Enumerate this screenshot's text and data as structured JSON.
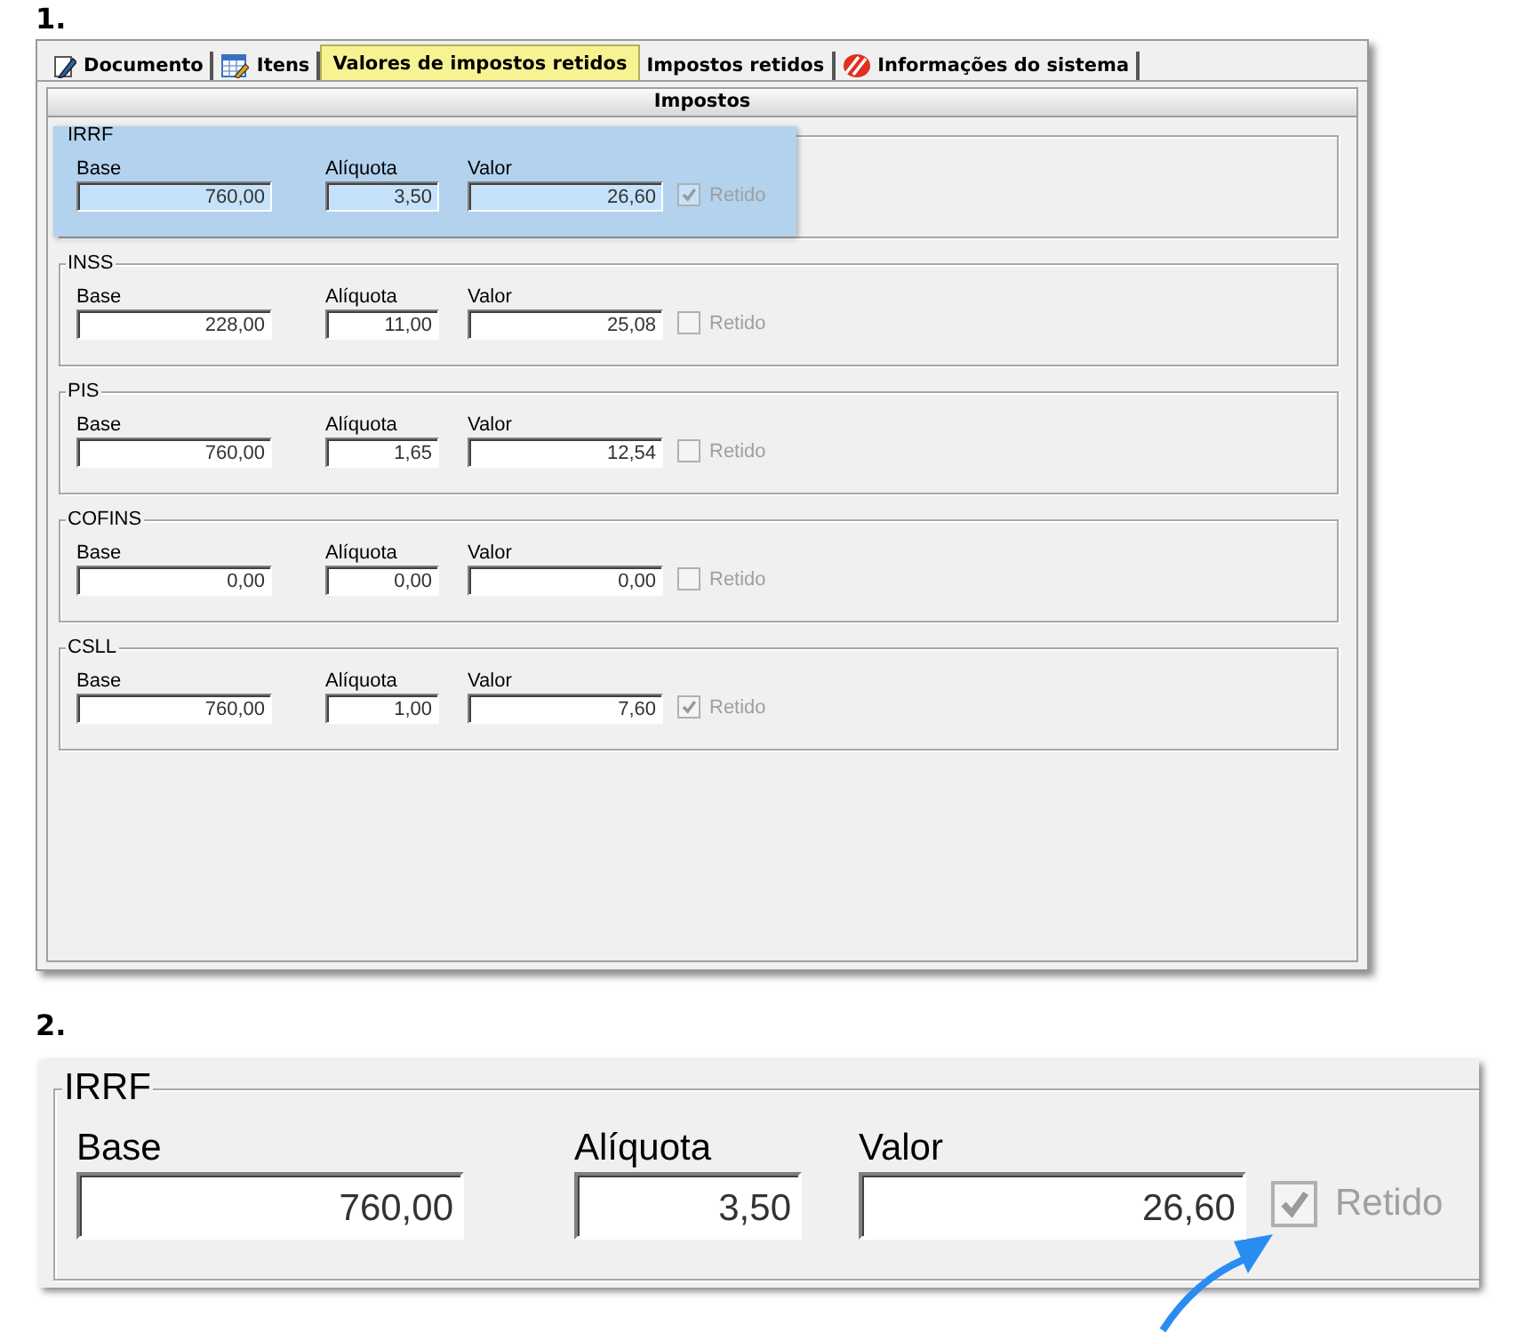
{
  "step_1": {
    "label": "1.",
    "tabs": [
      {
        "label": "Documento",
        "selected": false
      },
      {
        "label": "Itens",
        "selected": false
      },
      {
        "label": "Valores de impostos retidos",
        "selected": true
      },
      {
        "label": "Impostos retidos",
        "selected": false
      },
      {
        "label": "Informações do sistema",
        "selected": false
      }
    ],
    "panel_title": "Impostos",
    "groups": [
      {
        "title": "IRRF",
        "highlighted": true,
        "fields": [
          {
            "label": "Base",
            "value": "760,00"
          },
          {
            "label": "Alíquota",
            "value": "3,50"
          },
          {
            "label": "Valor",
            "value": "26,60"
          }
        ],
        "retained": {
          "label": "Retido",
          "checked": true
        }
      },
      {
        "title": "INSS",
        "highlighted": false,
        "fields": [
          {
            "label": "Base",
            "value": "228,00"
          },
          {
            "label": "Alíquota",
            "value": "11,00"
          },
          {
            "label": "Valor",
            "value": "25,08"
          }
        ],
        "retained": {
          "label": "Retido",
          "checked": false
        }
      },
      {
        "title": "PIS",
        "highlighted": false,
        "fields": [
          {
            "label": "Base",
            "value": "760,00"
          },
          {
            "label": "Alíquota",
            "value": "1,65"
          },
          {
            "label": "Valor",
            "value": "12,54"
          }
        ],
        "retained": {
          "label": "Retido",
          "checked": false
        }
      },
      {
        "title": "COFINS",
        "highlighted": false,
        "fields": [
          {
            "label": "Base",
            "value": "0,00"
          },
          {
            "label": "Alíquota",
            "value": "0,00"
          },
          {
            "label": "Valor",
            "value": "0,00"
          }
        ],
        "retained": {
          "label": "Retido",
          "checked": false
        }
      },
      {
        "title": "CSLL",
        "highlighted": false,
        "fields": [
          {
            "label": "Base",
            "value": "760,00"
          },
          {
            "label": "Alíquota",
            "value": "1,00"
          },
          {
            "label": "Valor",
            "value": "7,60"
          }
        ],
        "retained": {
          "label": "Retido",
          "checked": true
        }
      }
    ]
  },
  "step_2": {
    "label": "2.",
    "group": {
      "title": "IRRF",
      "fields": [
        {
          "label": "Base",
          "value": "760,00"
        },
        {
          "label": "Alíquota",
          "value": "3,50"
        },
        {
          "label": "Valor",
          "value": "26,60"
        }
      ],
      "retained": {
        "label": "Retido",
        "checked": true
      }
    }
  }
}
